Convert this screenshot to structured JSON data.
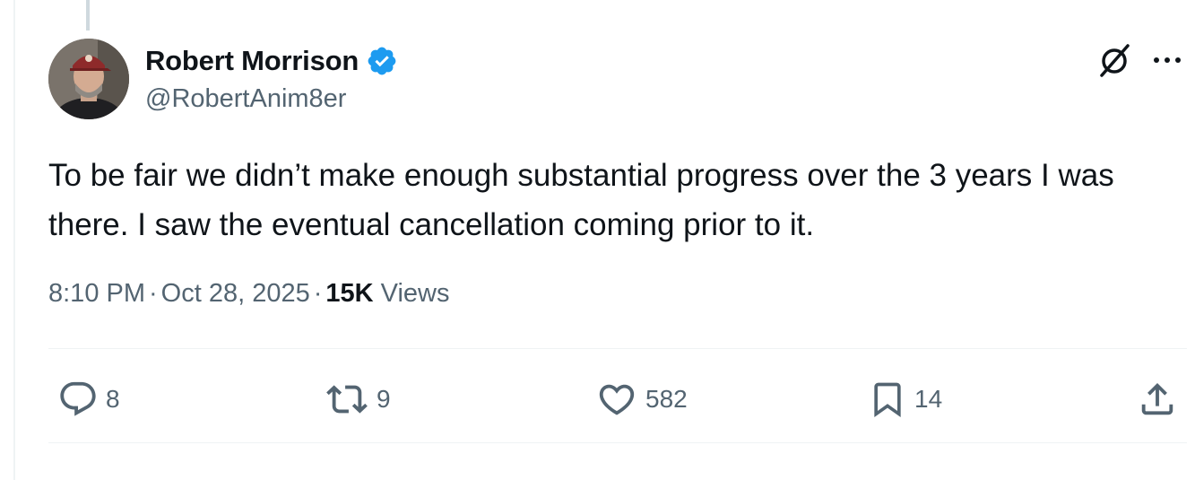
{
  "author": {
    "display_name": "Robert Morrison",
    "handle": "@RobertAnim8er",
    "verified": true,
    "verified_color": "#1d9bf0"
  },
  "icons": {
    "grok": "grok-slash-icon",
    "more": "more-horizontal-icon",
    "reply": "reply-bubble-icon",
    "repost": "repost-arrows-icon",
    "like": "heart-icon",
    "bookmark": "bookmark-icon",
    "share": "share-upload-icon"
  },
  "tweet": {
    "text": "To be fair we didn’t make enough substantial progress over the 3 years I was there. I saw the eventual cancellation coming prior to it.",
    "time": "8:10 PM",
    "separator": "·",
    "date": "Oct 28, 2025",
    "views_count": "15K",
    "views_label": "Views"
  },
  "actions": {
    "replies": "8",
    "reposts": "9",
    "likes": "582",
    "bookmarks": "14"
  },
  "colors": {
    "text_primary": "#0f1419",
    "text_secondary": "#536471",
    "divider": "#eff3f4"
  }
}
